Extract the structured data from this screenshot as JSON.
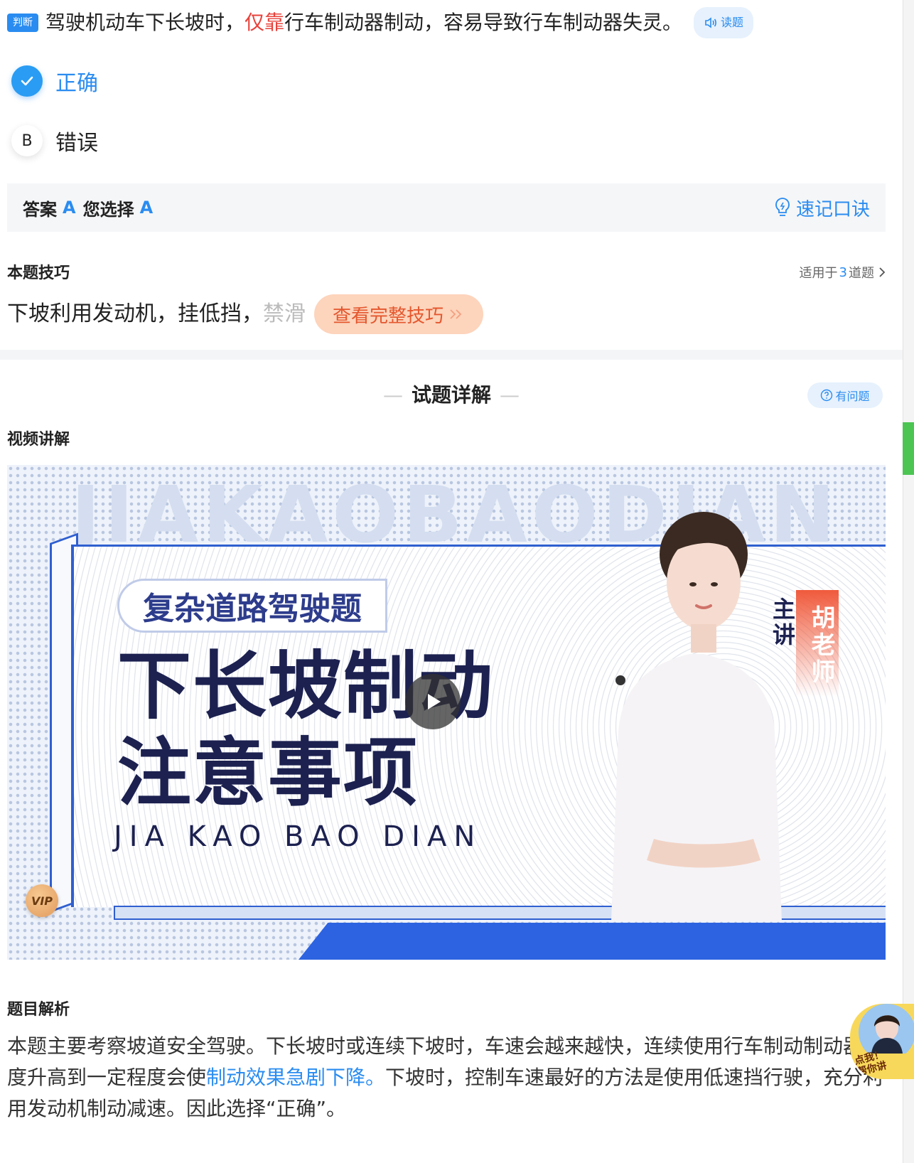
{
  "question": {
    "type_badge": "判断",
    "text_before": "驾驶机动车下长坡时，",
    "text_highlight": "仅靠",
    "text_after": "行车制动器制动，容易导致行车制动器失灵。",
    "read_label": "读题"
  },
  "options": [
    {
      "key": "A",
      "label": "正确",
      "selected": true
    },
    {
      "key": "B",
      "label": "错误",
      "selected": false
    }
  ],
  "answer_bar": {
    "answer_label": "答案",
    "answer_value": "A",
    "choice_label": "您选择",
    "choice_value": "A",
    "mnemonic_label": "速记口诀"
  },
  "tips": {
    "title": "本题技巧",
    "apply_prefix": "适用于",
    "apply_count": "3",
    "apply_suffix": "道题",
    "text": "下坡利用发动机，挂低挡，",
    "text_fade": "禁滑",
    "view_button": "查看完整技巧"
  },
  "explain": {
    "section_title": "试题详解",
    "issue_button": "有问题",
    "video_title": "视频讲解",
    "analysis_title": "题目解析",
    "analysis_part1": "本题主要考察坡道安全驾驶。下长坡时或连续下坡时，车速会越来越快，连续使用行车制动制动器温度升高到一定程度会使",
    "analysis_link": "制动效果急剧下降。",
    "analysis_part2": "下坡时，控制车速最好的方法是使用低速挡行驶，充分利用发动机制动减速。因此选择“正确”。"
  },
  "video": {
    "bg_letters": "JIAKAOBAODIAN",
    "subtitle": "复杂道路驾驶题",
    "headline_line1": "下长坡制动",
    "headline_line2": "注意事项",
    "pinyin": "JIA KAO BAO DIAN",
    "host_label": "主讲",
    "teacher_name": "胡老师",
    "vip_badge": "VIP"
  },
  "helper": {
    "text_line1": "点我！",
    "text_line2": "帮你讲"
  },
  "colors": {
    "accent": "#2a8cf0",
    "highlight_red": "#e8423b",
    "tips_orange": "#e4572e",
    "video_blue": "#2d63e0",
    "headline_navy": "#1c2150"
  }
}
